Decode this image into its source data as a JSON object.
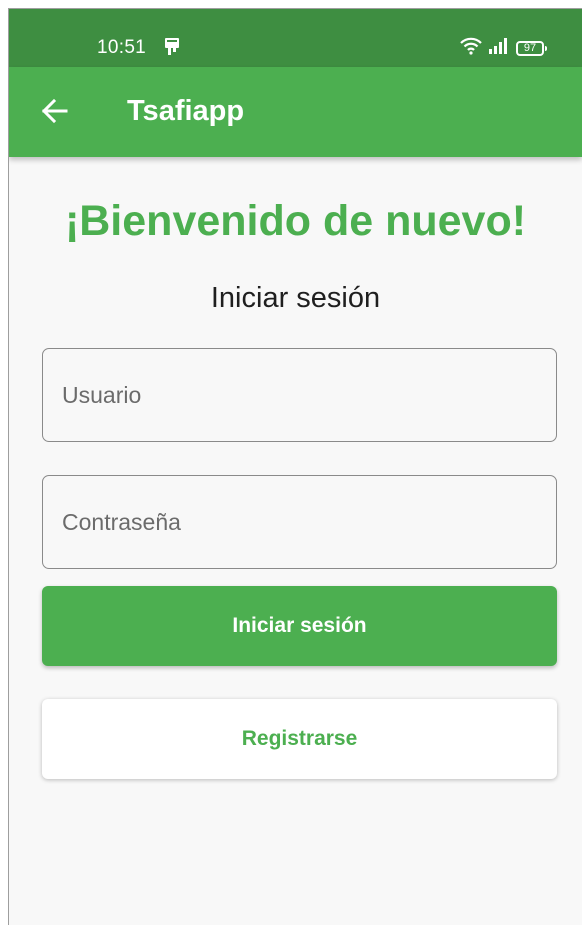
{
  "status_bar": {
    "time": "10:51",
    "battery_level": "97",
    "icons": [
      "notification-icon",
      "wifi-icon",
      "signal-icon",
      "battery-icon"
    ]
  },
  "app_bar": {
    "title": "Tsafiapp",
    "back_icon": "arrow-left-icon"
  },
  "login": {
    "welcome": "¡Bienvenido de nuevo!",
    "subtitle": "Iniciar sesión",
    "username_placeholder": "Usuario",
    "password_placeholder": "Contraseña",
    "login_button": "Iniciar sesión",
    "register_button": "Registrarse"
  },
  "colors": {
    "primary": "#4caf50",
    "status_bar": "#3e8e41",
    "background": "#f8f8f8"
  }
}
